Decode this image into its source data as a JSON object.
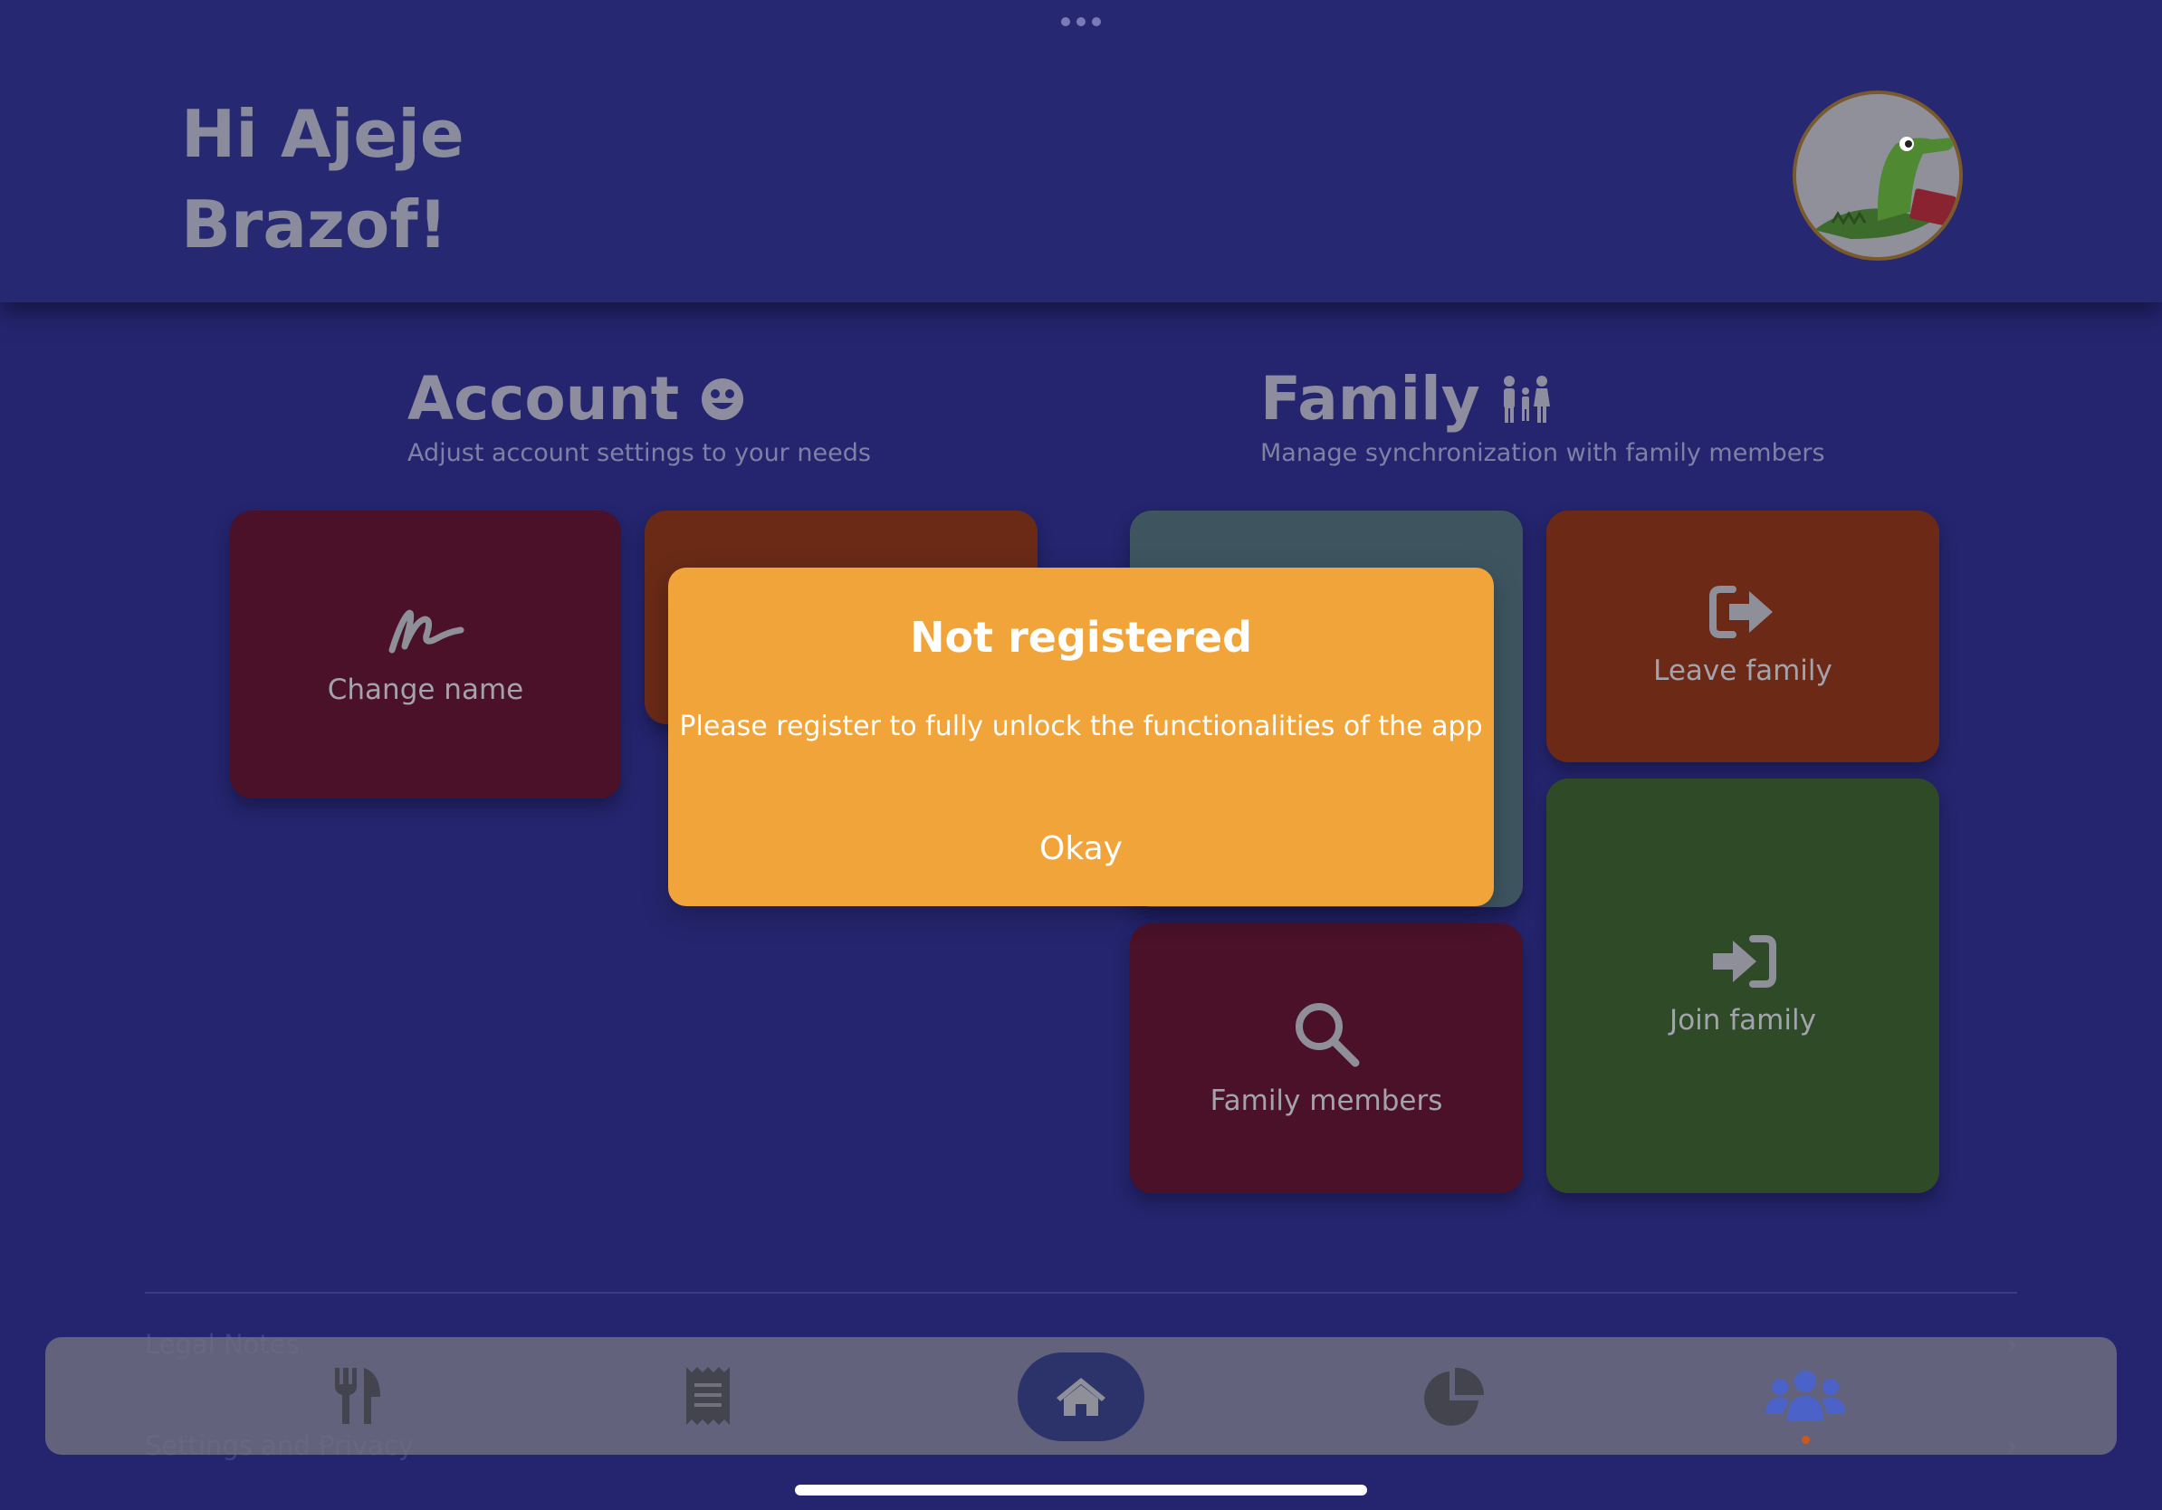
{
  "header": {
    "greeting_line1": "Hi Ajeje",
    "greeting_line2": "Brazof!",
    "avatar_icon": "crocodile-avatar-icon"
  },
  "account": {
    "title": "Account",
    "title_icon": "smiley-icon",
    "subtitle": "Adjust account settings to your needs",
    "tiles": [
      {
        "label": "Change name",
        "icon": "signature-icon",
        "color": "#4a1128"
      },
      {
        "label": "",
        "icon": "unknown-icon",
        "color": "#6a2a16"
      }
    ]
  },
  "family": {
    "title": "Family",
    "title_icon": "family-icon",
    "subtitle": "Manage synchronization with family members",
    "tiles": [
      {
        "label": "",
        "icon": "",
        "color": "#3e5560"
      },
      {
        "label": "Leave family",
        "icon": "sign-out-icon",
        "color": "#6b2916"
      },
      {
        "label": "Family members",
        "icon": "search-icon",
        "color": "#4a1128"
      },
      {
        "label": "Join family",
        "icon": "sign-in-icon",
        "color": "#2f4a27"
      }
    ]
  },
  "list": {
    "legal_notes": "Legal Notes",
    "settings_privacy": "Settings and Privacy"
  },
  "tabbar": {
    "tabs": [
      "cutlery-icon",
      "receipt-icon",
      "home-icon",
      "pie-chart-icon",
      "users-icon"
    ],
    "active": "home-icon",
    "accent_color": "#4b63c8"
  },
  "dialog": {
    "title": "Not registered",
    "message": "Please register to fully unlock the functionalities of the app",
    "button": "Okay",
    "color": "#f0a43a"
  }
}
